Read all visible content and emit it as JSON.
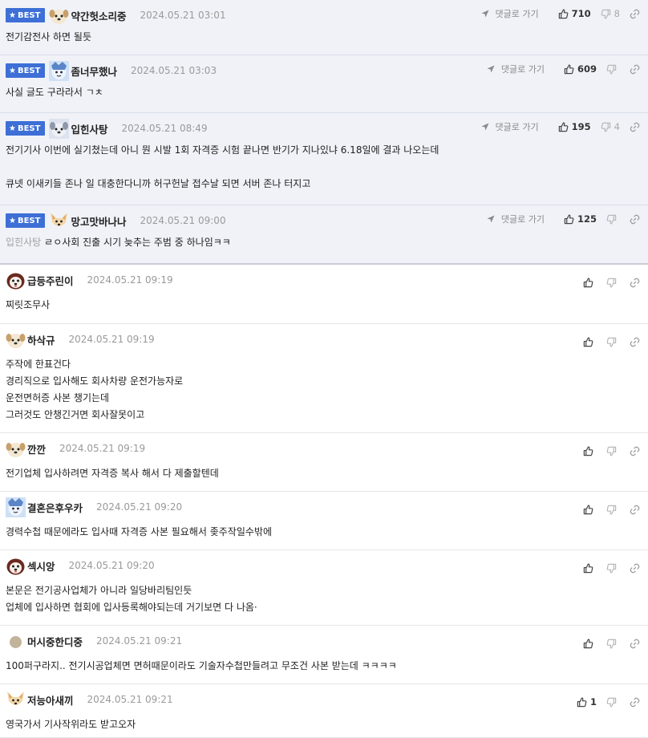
{
  "ui": {
    "best_label": "BEST",
    "goto_label": "댓글로 가기"
  },
  "comments": [
    {
      "best": true,
      "avatar": "dog-beige",
      "nick": "약간헛소리중",
      "date": "2024.05.21 03:01",
      "lines": [
        "전기감전사 하면 될듯"
      ],
      "up": "710",
      "down": "8"
    },
    {
      "best": true,
      "avatar": "blue-character",
      "nick": "좀너무했나",
      "date": "2024.05.21 03:03",
      "lines": [
        "사실 글도 구라라서 ㄱㅊ"
      ],
      "up": "609",
      "down": ""
    },
    {
      "best": true,
      "avatar": "dog-gray",
      "nick": "입힌사탕",
      "date": "2024.05.21 08:49",
      "lines": [
        "전기기사 이번에 실기쳤는데 아니 뭔 시발 1회 자격증 시험 끝나면 반기가 지나있냐 6.18일에 결과 나오는데",
        "",
        "큐넷 이새키들 존나 일 대충한다니까 허구헌날 접수날 되면 서버 존나 터지고"
      ],
      "up": "195",
      "down": "4"
    },
    {
      "best": true,
      "avatar": "fox",
      "nick": "망고맛바나나",
      "date": "2024.05.21 09:00",
      "reply_to": "입힌사탕",
      "lines": [
        "ㄹㅇ사회 진출 시기 늦추는 주범 중 하나임ㅋㅋ"
      ],
      "up": "125",
      "down": ""
    },
    {
      "best": false,
      "avatar": "dog-red",
      "nick": "급등주린이",
      "date": "2024.05.21 09:19",
      "lines": [
        "찌릿조무사"
      ],
      "up": "",
      "down": ""
    },
    {
      "best": false,
      "avatar": "dog-beige",
      "nick": "하삭규",
      "date": "2024.05.21 09:19",
      "lines": [
        "주작에 한표건다",
        "경리직으로 입사해도 회사차량 운전가능자로",
        "운전면허증 사본 챙기는데",
        "그러것도 안챙긴거면 회사잘못이고"
      ],
      "up": "",
      "down": ""
    },
    {
      "best": false,
      "avatar": "dog-beige",
      "nick": "깐깐",
      "date": "2024.05.21 09:19",
      "lines": [
        "전기업체 입사하려면 자격증 복사 해서 다 제출할텐데"
      ],
      "up": "",
      "down": ""
    },
    {
      "best": false,
      "avatar": "blue-character",
      "nick": "결혼은후우카",
      "date": "2024.05.21 09:20",
      "lines": [
        "경력수첩 때문에라도 입사때 자격증 사본 필요해서 좆주작일수밖에"
      ],
      "up": "",
      "down": ""
    },
    {
      "best": false,
      "avatar": "dog-red",
      "nick": "섹시앙",
      "date": "2024.05.21 09:20",
      "lines": [
        "본문은 전기공사업체가 아니라 일당바리팀인듯",
        "업체에 입사하면 협회에 입사등록해야되는데 거기보면 다 나옴·"
      ],
      "up": "",
      "down": ""
    },
    {
      "best": false,
      "avatar": "circle",
      "nick": "머시중한디중",
      "date": "2024.05.21 09:21",
      "lines": [
        "100퍼구라지.. 전기시공업체면 면허때문이라도 기술자수첩만들려고 무조건 사본 받는데 ㅋㅋㅋㅋ"
      ],
      "up": "",
      "down": ""
    },
    {
      "best": false,
      "avatar": "fox",
      "nick": "저능아새끼",
      "date": "2024.05.21 09:21",
      "lines": [
        "영국가서 기사작위라도 받고오자"
      ],
      "up": "1",
      "down": ""
    }
  ]
}
